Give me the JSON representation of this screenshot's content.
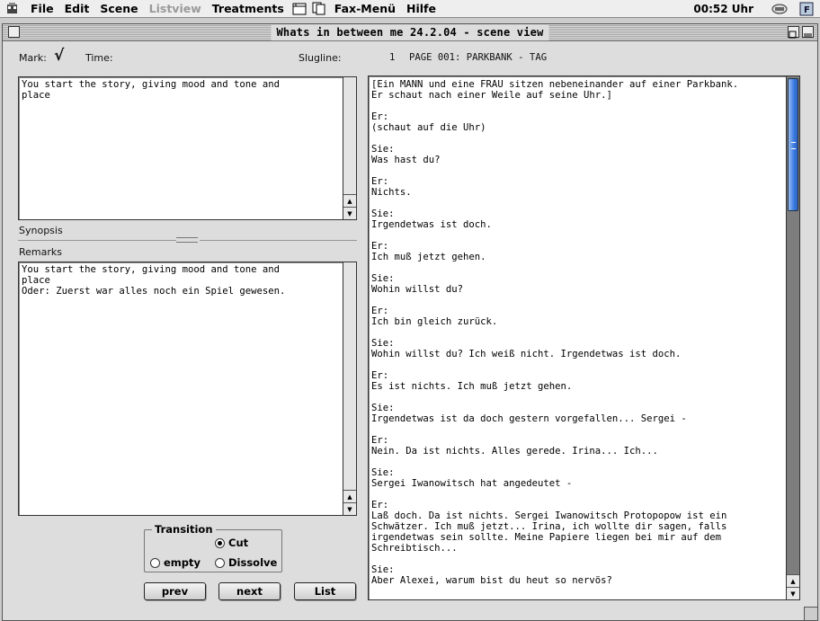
{
  "menubar": {
    "items": [
      "File",
      "Edit",
      "Scene",
      "Listview",
      "Treatments",
      "Fax-Menü",
      "Hilfe"
    ],
    "disabled_item": "Listview",
    "clock": "00:52 Uhr"
  },
  "window": {
    "title": "Whats in between me 24.2.04 - scene view"
  },
  "header": {
    "mark_label": "Mark:",
    "mark_value": "√",
    "time_label": "Time:",
    "slugline_label": "Slugline:",
    "slugline_number": "1",
    "slugline_text": "PAGE 001: PARKBANK - TAG"
  },
  "synopsis": {
    "text": "You start the story, giving mood and tone and\nplace",
    "label": "Synopsis"
  },
  "remarks": {
    "label": "Remarks",
    "text": "You start the story, giving mood and tone and\nplace\nOder: Zuerst war alles noch ein Spiel gewesen."
  },
  "script": {
    "blocks": [
      "[Ein MANN und eine FRAU sitzen nebeneinander auf einer Parkbank.\nEr schaut nach einer Weile auf seine Uhr.]",
      "Er:\n(schaut auf die Uhr)",
      "Sie:\nWas hast du?",
      "Er:\nNichts.",
      "Sie:\nIrgendetwas ist doch.",
      "Er:\nIch muß jetzt gehen.",
      "Sie:\nWohin willst du?",
      "Er:\nIch bin gleich zurück.",
      "Sie:\nWohin willst du? Ich weiß nicht. Irgendetwas ist doch.",
      "Er:\nEs ist nichts. Ich muß jetzt gehen.",
      "Sie:\nIrgendetwas ist da doch gestern vorgefallen... Sergei -",
      "Er:\nNein. Da ist nichts. Alles gerede. Irina... Ich...",
      "Sie:\nSergei Iwanowitsch hat angedeutet -",
      "Er:\nLaß doch. Da ist nichts. Sergei Iwanowitsch Protopopow ist ein\nSchwätzer. Ich muß jetzt... Irina, ich wollte dir sagen, falls\nirgendetwas sein sollte. Meine Papiere liegen bei mir auf dem\nSchreibtisch...",
      "Sie:\nAber Alexei, warum bist du heut so nervös?"
    ]
  },
  "transition": {
    "legend": "Transition",
    "options": [
      "Cut",
      "empty",
      "Dissolve"
    ],
    "selected": "Cut"
  },
  "buttons": {
    "prev": "prev",
    "next": "next",
    "list": "List"
  }
}
